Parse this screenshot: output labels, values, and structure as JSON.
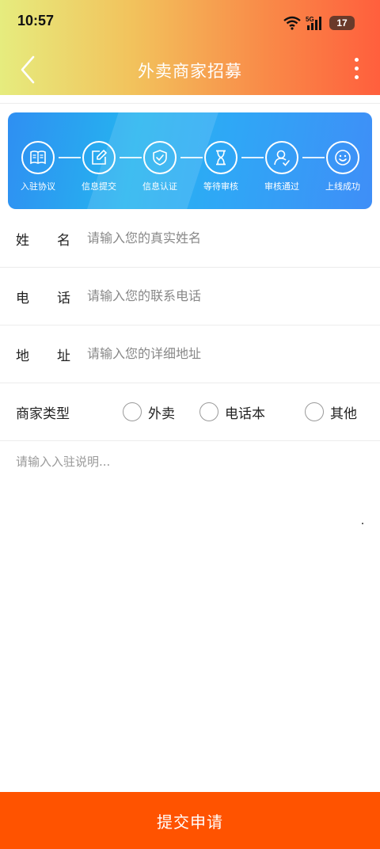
{
  "status_bar": {
    "time": "10:57",
    "network": "5G",
    "battery": "17"
  },
  "nav": {
    "title": "外卖商家招募"
  },
  "steps": [
    {
      "label": "入驻协议",
      "icon": "book-icon"
    },
    {
      "label": "信息提交",
      "icon": "edit-icon"
    },
    {
      "label": "信息认证",
      "icon": "shield-check-icon"
    },
    {
      "label": "等待审核",
      "icon": "hourglass-icon"
    },
    {
      "label": "审核通过",
      "icon": "user-check-icon"
    },
    {
      "label": "上线成功",
      "icon": "smile-icon"
    }
  ],
  "form": {
    "name": {
      "label_a": "姓",
      "label_b": "名",
      "placeholder": "请输入您的真实姓名",
      "value": ""
    },
    "phone": {
      "label_a": "电",
      "label_b": "话",
      "placeholder": "请输入您的联系电话",
      "value": ""
    },
    "address": {
      "label_a": "地",
      "label_b": "址",
      "placeholder": "请输入您的详细地址",
      "value": ""
    },
    "type": {
      "label": "商家类型",
      "options": [
        "外卖",
        "电话本",
        "其他"
      ],
      "selected": ""
    },
    "description": {
      "placeholder": "请输入入驻说明...",
      "value": ""
    }
  },
  "submit_label": "提交申请",
  "colors": {
    "accent": "#ff5300",
    "steps_bg": "#2fa7f6"
  }
}
